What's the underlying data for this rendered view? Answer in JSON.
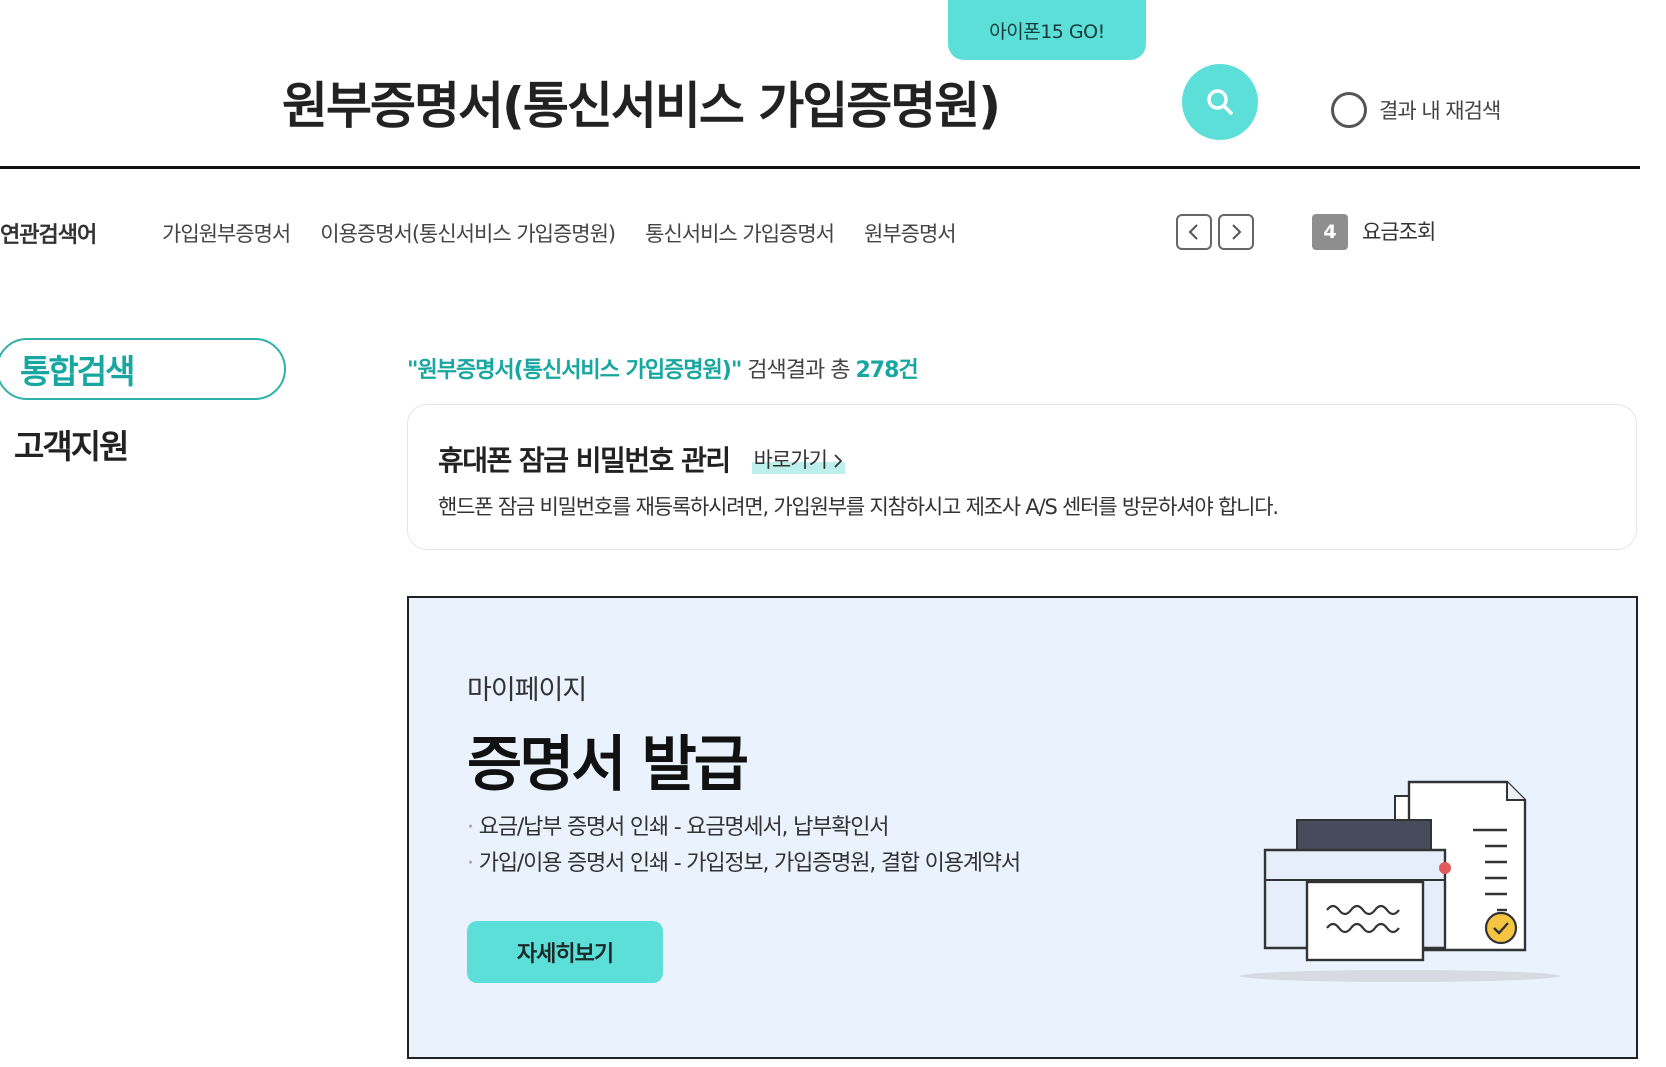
{
  "promo": {
    "label": "아이폰15 GO!"
  },
  "search": {
    "query": "원부증명서(통신서비스 가입증명원)",
    "button_icon": "search-icon",
    "research_label": "결과 내 재검색"
  },
  "related": {
    "title": "연관검색어",
    "items": [
      "가입원부증명서",
      "이용증명서(통신서비스 가입증명원)",
      "통신서비스 가입증명서",
      "원부증명서"
    ],
    "rank_number": "4",
    "rank_label": "요금조회"
  },
  "sidebar": {
    "items": [
      {
        "label": "통합검색",
        "active": true
      },
      {
        "label": "고객지원",
        "active": false
      }
    ]
  },
  "results": {
    "query_quoted": "\"원부증명서(통신서비스 가입증명원)\"",
    "count_prefix": " 검색결과 총 ",
    "count": "278건"
  },
  "card": {
    "title": "휴대폰 잠금 비밀번호 관리",
    "link_label": "바로가기",
    "description": "핸드폰 잠금 비밀번호를 재등록하시려면, 가입원부를 지참하시고 제조사 A/S 센터를 방문하셔야 합니다."
  },
  "banner": {
    "subtitle": "마이페이지",
    "title": "증명서 발급",
    "bullets": [
      "요금/납부 증명서 인쇄 - 요금명세서, 납부확인서",
      "가입/이용 증명서 인쇄 - 가입정보, 가입증명원, 결합 이용계약서"
    ],
    "button_label": "자세히보기"
  },
  "colors": {
    "accent": "#5ddfd9",
    "accent_text": "#17a7a0",
    "banner_bg": "#eaf3fd"
  }
}
